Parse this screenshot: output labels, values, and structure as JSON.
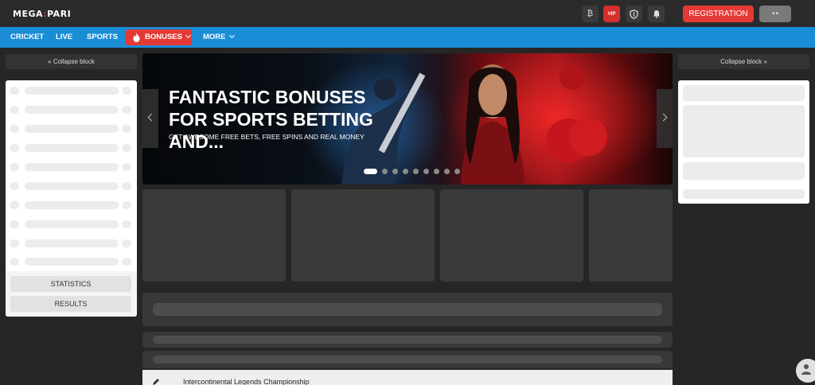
{
  "header": {
    "logo_left": "MEGA",
    "logo_colon": ":",
    "logo_right": "PARI",
    "icons": [
      {
        "name": "bitcoin-icon",
        "glyph": "₿"
      },
      {
        "name": "vip-icon",
        "label": "VIP"
      },
      {
        "name": "shield-icon",
        "glyph": "⛉"
      },
      {
        "name": "bell-icon",
        "glyph": "🔔"
      }
    ],
    "registration_label": "REGISTRATION",
    "login_label": "■ ■"
  },
  "nav": {
    "items": [
      "CRICKET",
      "LIVE",
      "SPORTS"
    ],
    "bonuses_label": "BONUSES",
    "more_label": "MORE"
  },
  "left_sidebar": {
    "collapse_label": "Collapse block",
    "statistics_label": "STATISTICS",
    "results_label": "RESULTS"
  },
  "right_sidebar": {
    "collapse_label": "Collapse block"
  },
  "banner": {
    "title": "FANTASTIC BONUSES FOR SPORTS BETTING AND...",
    "subtitle": "GET AWESOME FREE BETS, FREE SPINS AND REAL MONEY",
    "slide_count": 9,
    "active_slide": 1
  },
  "events": {
    "first_event": "Intercontinental Legends Championship"
  },
  "colors": {
    "accent_red": "#e53935",
    "nav_blue": "#1a8dd6",
    "background": "#262626"
  }
}
